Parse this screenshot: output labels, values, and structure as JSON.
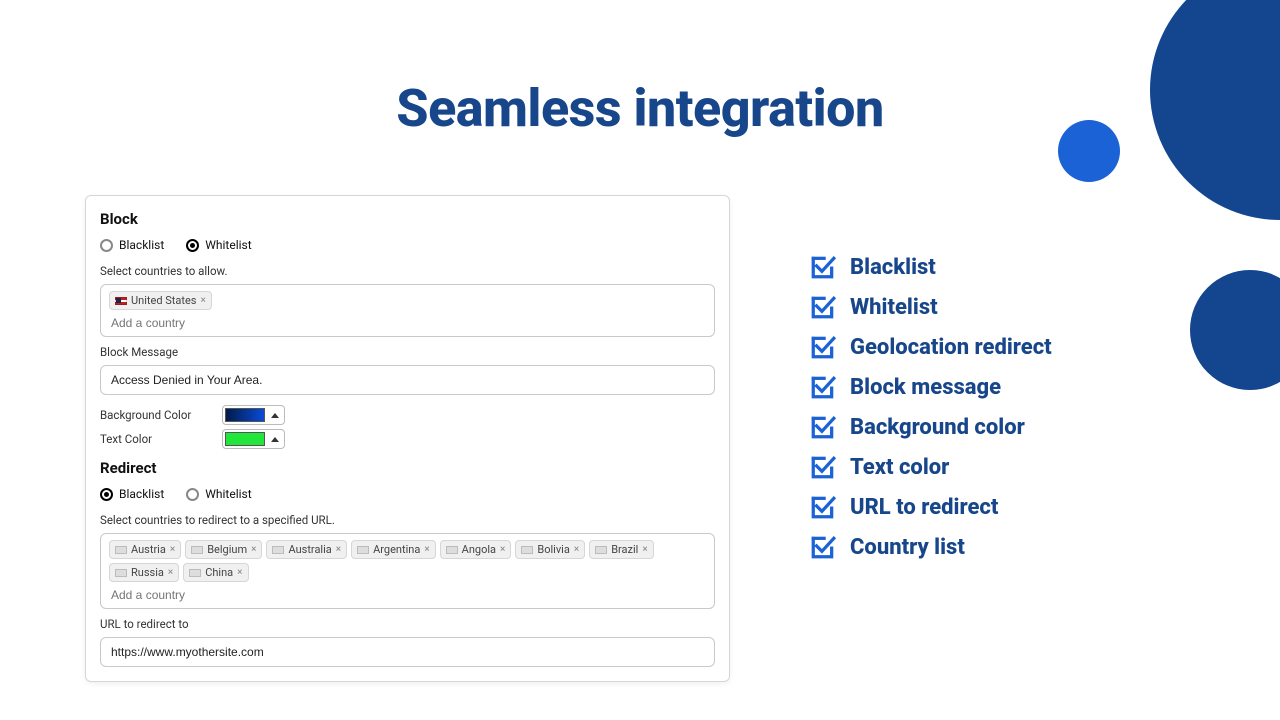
{
  "hero": {
    "title": "Seamless integration"
  },
  "panel": {
    "block": {
      "heading": "Block",
      "radio_blacklist": "Blacklist",
      "radio_whitelist": "Whitelist",
      "countries_label": "Select countries to allow.",
      "countries": [
        "United States"
      ],
      "countries_placeholder": "Add a country",
      "message_label": "Block Message",
      "message_value": "Access Denied in Your Area.",
      "bg_label": "Background Color",
      "text_color_label": "Text Color",
      "bg_color": "#0a4bd8",
      "text_color": "#22e63b"
    },
    "redirect": {
      "heading": "Redirect",
      "radio_blacklist": "Blacklist",
      "radio_whitelist": "Whitelist",
      "countries_label": "Select countries to redirect to a specified URL.",
      "countries": [
        "Austria",
        "Belgium",
        "Australia",
        "Argentina",
        "Angola",
        "Bolivia",
        "Brazil",
        "Russia",
        "China"
      ],
      "countries_placeholder": "Add a country",
      "url_label": "URL to redirect to",
      "url_value": "https://www.myothersite.com"
    }
  },
  "features": [
    "Blacklist",
    "Whitelist",
    "Geolocation redirect",
    "Block message",
    "Background color",
    "Text color",
    "URL to redirect",
    "Country list"
  ],
  "colors": {
    "brand": "#17468a",
    "accent": "#1a62d6"
  }
}
